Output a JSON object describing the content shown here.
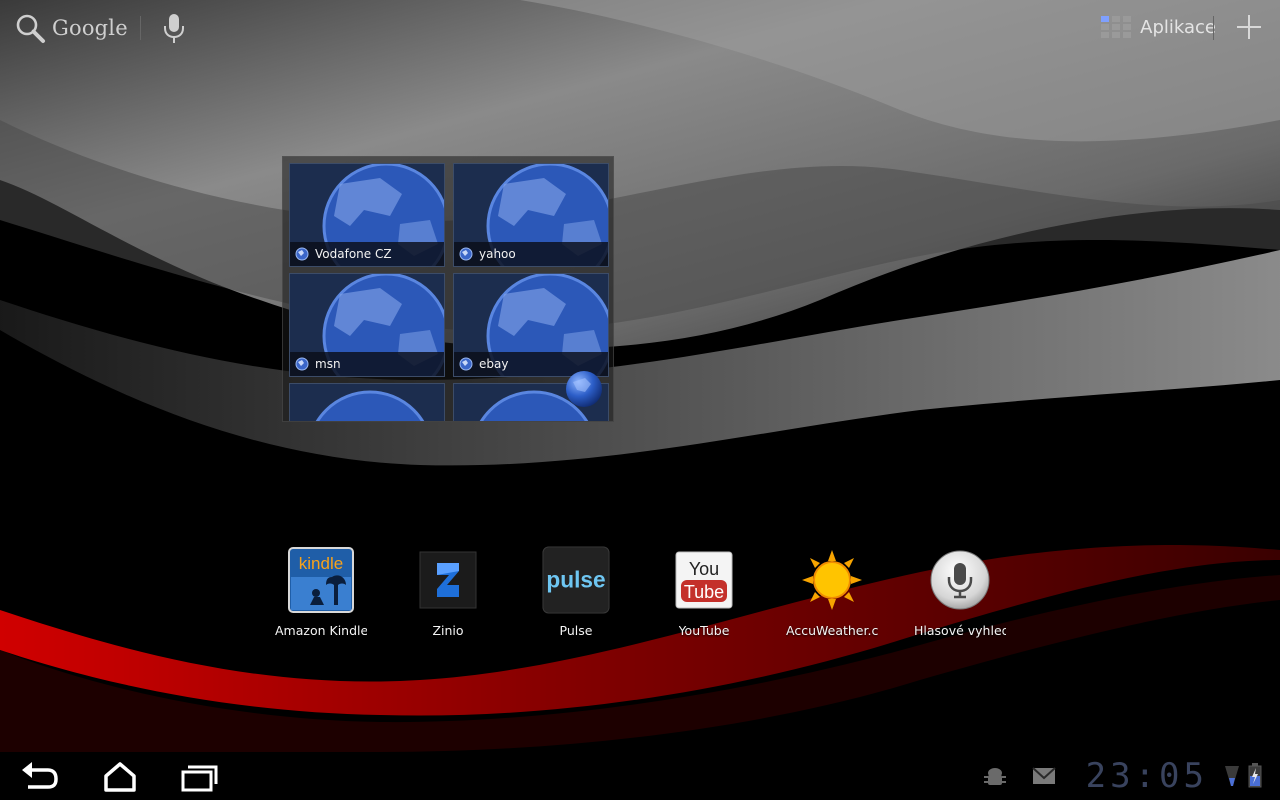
{
  "search": {
    "label": "Google"
  },
  "apps_button": {
    "label": "Aplikace"
  },
  "bookmarks": [
    {
      "label": "Vodafone CZ"
    },
    {
      "label": "yahoo"
    },
    {
      "label": "msn"
    },
    {
      "label": "ebay"
    }
  ],
  "dock": [
    {
      "label": "Amazon Kindle",
      "icon": "kindle-icon",
      "icon_text": "kindle"
    },
    {
      "label": "Zinio",
      "icon": "zinio-icon"
    },
    {
      "label": "Pulse",
      "icon": "pulse-icon",
      "icon_text": "pulse"
    },
    {
      "label": "YouTube",
      "icon": "youtube-icon",
      "icon_text_top": "You",
      "icon_text_bottom": "Tube"
    },
    {
      "label": "AccuWeather.co",
      "icon": "sun-icon"
    },
    {
      "label": "Hlasové vyhled",
      "icon": "microphone-icon"
    }
  ],
  "status_bar": {
    "time": "23:05"
  },
  "colors": {
    "clock": "#39435e",
    "accent_red": "#c00000",
    "tile_blue": "#1c2d4e"
  }
}
